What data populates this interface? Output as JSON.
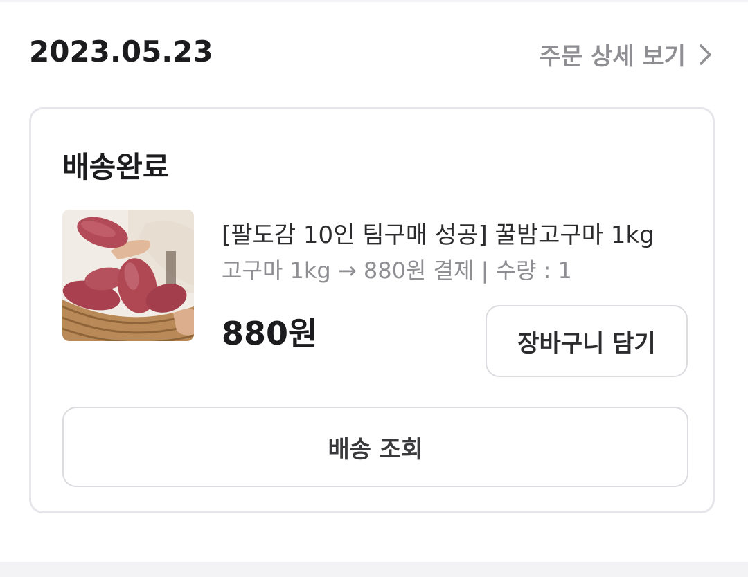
{
  "order": {
    "date": "2023.05.23",
    "detail_link_label": "주문 상세 보기",
    "detail_link_icon": "chevron-right-icon"
  },
  "card": {
    "status": "배송완료",
    "product": {
      "image": "sweet-potato-photo",
      "name": "[팔도감 10인 팀구매 성공] 꿀밤고구마 1kg",
      "option": "고구마 1kg → 880원 결제 | 수량 : 1",
      "price": "880원"
    },
    "cart_button_label": "장바구니 담기",
    "track_button_label": "배송 조회"
  },
  "colors": {
    "text_primary": "#1c1c1e",
    "text_secondary": "#8e8e93",
    "border": "#dcdce0",
    "card_border": "#e6e6ea",
    "background_strip": "#f3f3f5"
  }
}
